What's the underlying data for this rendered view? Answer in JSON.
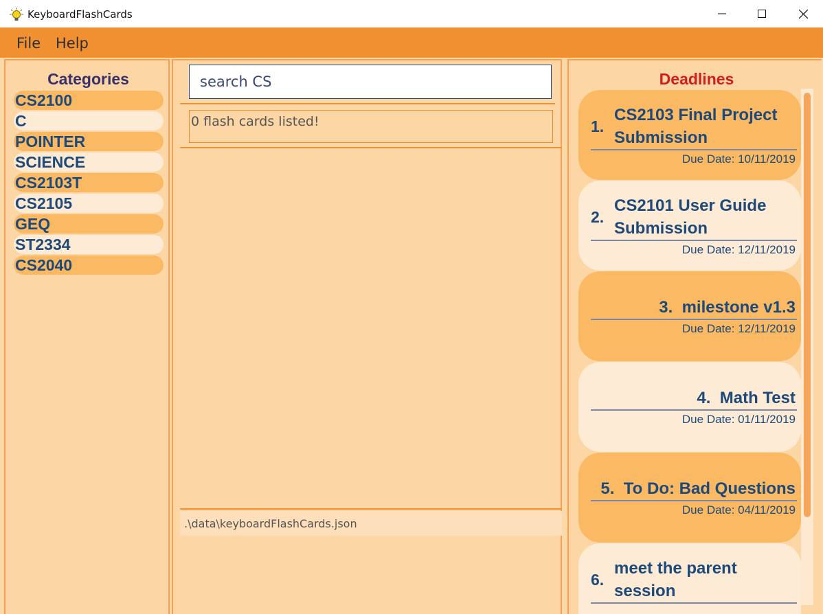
{
  "window": {
    "title": "KeyboardFlashCards"
  },
  "menu": {
    "file": "File",
    "help": "Help"
  },
  "categories": {
    "title": "Categories",
    "items": [
      "CS2100",
      "C",
      "POINTER",
      "SCIENCE",
      "CS2103T",
      "CS2105",
      "GEQ",
      "ST2334",
      "CS2040"
    ]
  },
  "search": {
    "value": "search CS"
  },
  "results": {
    "message": "0  flash cards listed!"
  },
  "status": {
    "path": ".\\data\\keyboardFlashCards.json"
  },
  "deadlines": {
    "title": "Deadlines",
    "items": [
      {
        "num": "1.",
        "line1": "CS2103 Final Project",
        "line2": "Submission",
        "date": "Due Date: 10/11/2019"
      },
      {
        "num": "2.",
        "line1": "CS2101 User Guide",
        "line2": "Submission",
        "date": "Due Date: 12/11/2019"
      },
      {
        "num": "3.",
        "line1": "milestone v1.3",
        "line2": "",
        "date": "Due Date: 12/11/2019"
      },
      {
        "num": "4.",
        "line1": "Math Test",
        "line2": "",
        "date": "Due Date: 01/11/2019"
      },
      {
        "num": "5.",
        "line1": "To Do: Bad Questions",
        "line2": "",
        "date": "Due Date: 04/11/2019"
      },
      {
        "num": "6.",
        "line1": "meet the parent",
        "line2": "session",
        "date": ""
      }
    ]
  },
  "colors": {
    "menu_bar": "#f19030",
    "panel_bg": "#fdd6a5",
    "card_dark": "#fbb964",
    "card_light": "#fdebd6",
    "text_blue": "#1d4a7a",
    "deadline_title": "#d21e1e"
  }
}
